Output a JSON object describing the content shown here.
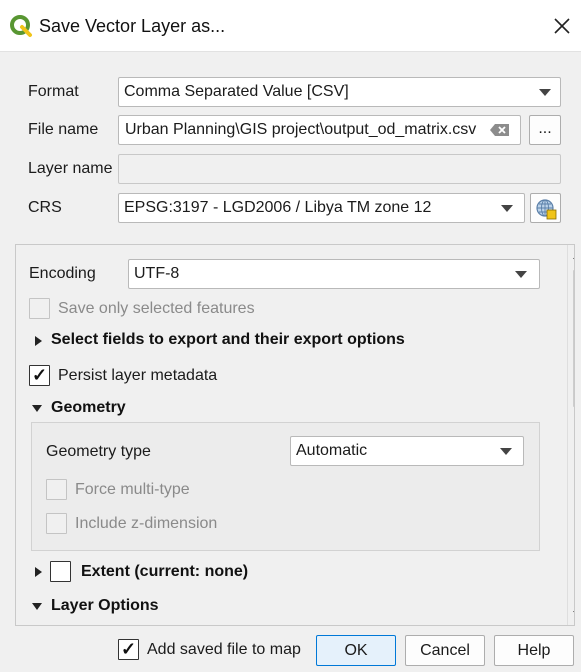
{
  "window": {
    "title": "Save Vector Layer as..."
  },
  "form": {
    "format_label": "Format",
    "format_value": "Comma Separated Value [CSV]",
    "filename_label": "File name",
    "filename_value": "Urban Planning\\GIS project\\output_od_matrix.csv",
    "browse_label": "...",
    "layername_label": "Layer name",
    "layername_value": "",
    "crs_label": "CRS",
    "crs_value": "EPSG:3197 - LGD2006 / Libya TM zone 12"
  },
  "options": {
    "encoding_label": "Encoding",
    "encoding_value": "UTF-8",
    "save_selected_label": "Save only selected features",
    "save_selected_checked": false,
    "select_fields_label": "Select fields to export and their export options",
    "persist_metadata_label": "Persist layer metadata",
    "persist_metadata_checked": true,
    "geometry_section_label": "Geometry",
    "geometry_type_label": "Geometry type",
    "geometry_type_value": "Automatic",
    "force_multi_label": "Force multi-type",
    "include_z_label": "Include z-dimension",
    "extent_label": "Extent (current: none)",
    "layer_options_label": "Layer Options"
  },
  "footer": {
    "add_to_map_label": "Add saved file to map",
    "add_to_map_checked": true,
    "ok_label": "OK",
    "cancel_label": "Cancel",
    "help_label": "Help"
  },
  "colors": {
    "qgis_green": "#589632",
    "qgis_yellow": "#f0c419",
    "ok_border": "#0078d7",
    "ok_fill": "#e5f1fb"
  },
  "icons": [
    "qgis-logo-icon",
    "close-icon",
    "clear-text-icon",
    "crs-globe-icon",
    "checkmark-icon",
    "scroll-up-icon",
    "scroll-down-icon"
  ]
}
